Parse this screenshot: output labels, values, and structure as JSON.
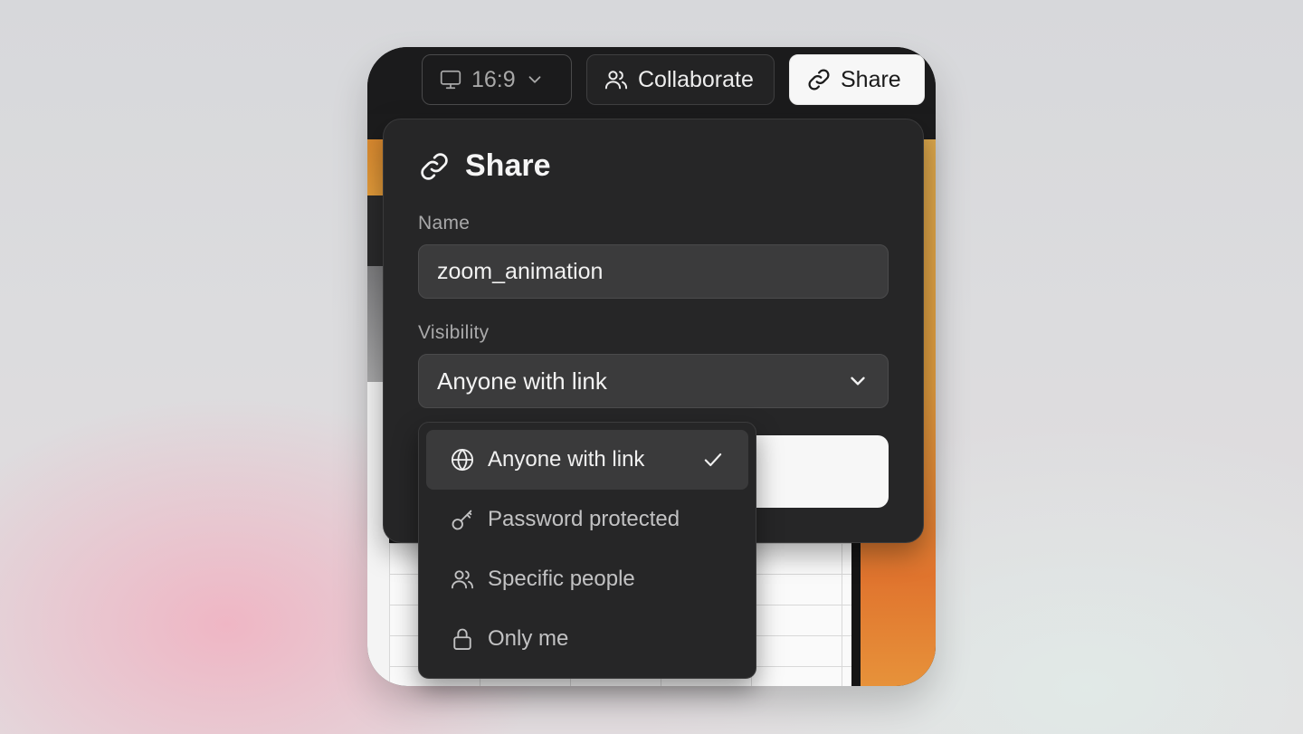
{
  "topbar": {
    "ratio_label": "16:9",
    "collaborate_label": "Collaborate",
    "share_label": "Share"
  },
  "share_panel": {
    "title": "Share",
    "name_label": "Name",
    "name_value": "zoom_animation",
    "visibility_label": "Visibility",
    "visibility_value": "Anyone with link"
  },
  "visibility_menu": {
    "items": [
      {
        "label": "Anyone with link",
        "icon": "globe-icon",
        "selected": true
      },
      {
        "label": "Password protected",
        "icon": "key-icon",
        "selected": false
      },
      {
        "label": "Specific people",
        "icon": "users-icon",
        "selected": false
      },
      {
        "label": "Only me",
        "icon": "lock-icon",
        "selected": false
      }
    ]
  },
  "colors": {
    "panel_bg": "#262627",
    "input_bg": "#3b3b3c",
    "primary_button": "#f7f7f7",
    "canvas_accent": "#e0742e"
  }
}
